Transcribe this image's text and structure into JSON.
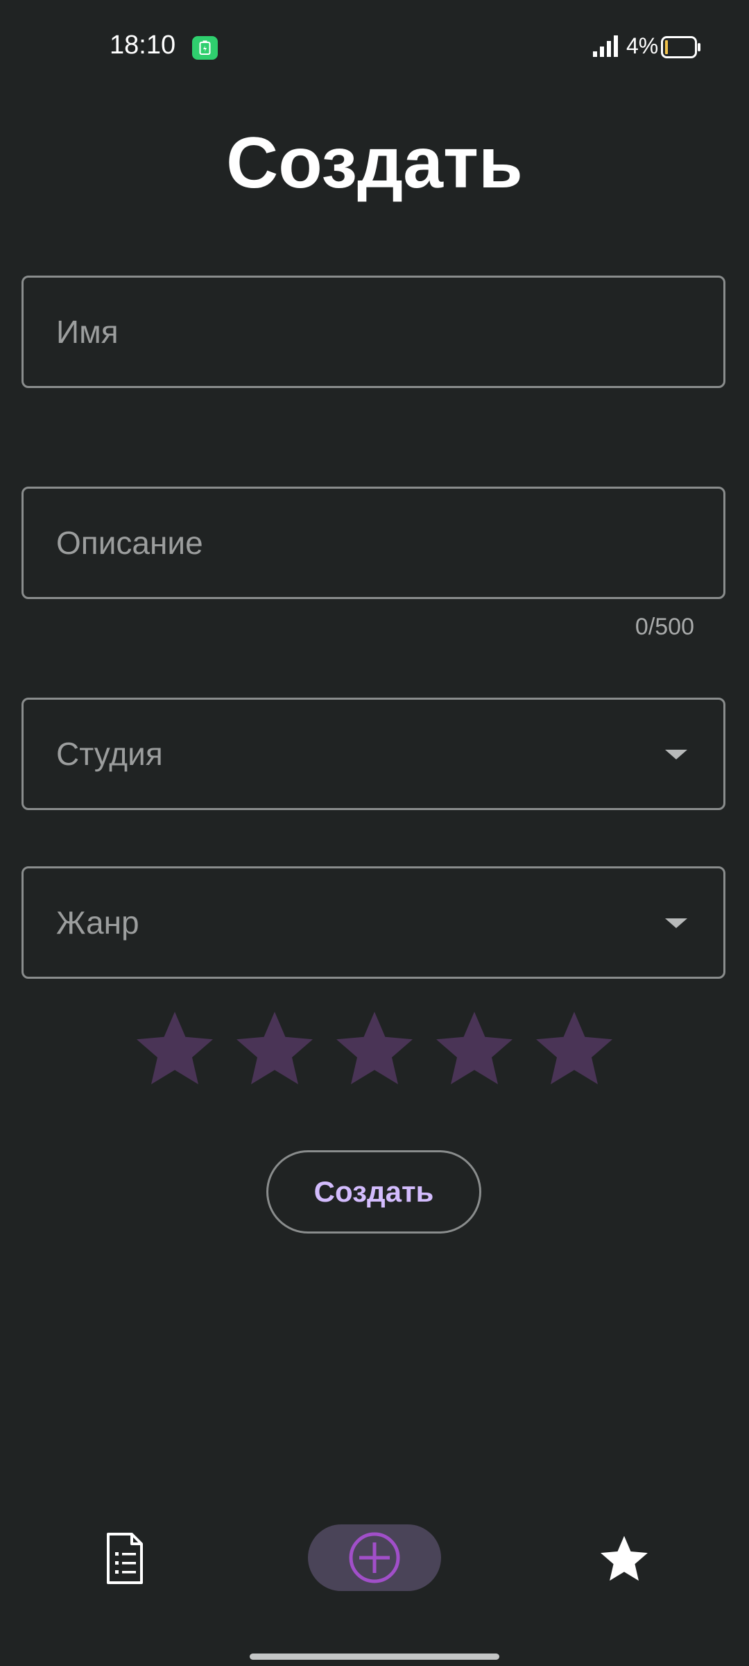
{
  "status_bar": {
    "time": "18:10",
    "battery_percent": "4%",
    "signal_icon": "signal-bars-icon",
    "battery_icon": "battery-low-icon",
    "app_icon": "battery-saver-icon",
    "app_icon_color": "#2fcf6e"
  },
  "title": "Создать",
  "form": {
    "name_field": {
      "placeholder": "Имя",
      "value": ""
    },
    "description_field": {
      "placeholder": "Описание",
      "value": "",
      "counter": "0/500"
    },
    "studio_select": {
      "placeholder": "Студия",
      "icon": "dropdown-arrow-icon"
    },
    "genre_select": {
      "placeholder": "Жанр",
      "icon": "dropdown-arrow-icon"
    },
    "rating": {
      "max": 5,
      "value": 0,
      "star_color": "#4a3456"
    },
    "submit_label": "Создать"
  },
  "bottom_nav": {
    "items": [
      {
        "name": "list",
        "icon": "document-list-icon",
        "active": false
      },
      {
        "name": "create",
        "icon": "add-circle-icon",
        "active": true
      },
      {
        "name": "favorites",
        "icon": "star-icon",
        "active": false
      }
    ],
    "active_color": "#a14fc9",
    "active_pill_color": "#4a4458"
  },
  "colors": {
    "background": "#202323",
    "accent_text": "#d3bcfd",
    "outline": "#8a8d8d"
  }
}
